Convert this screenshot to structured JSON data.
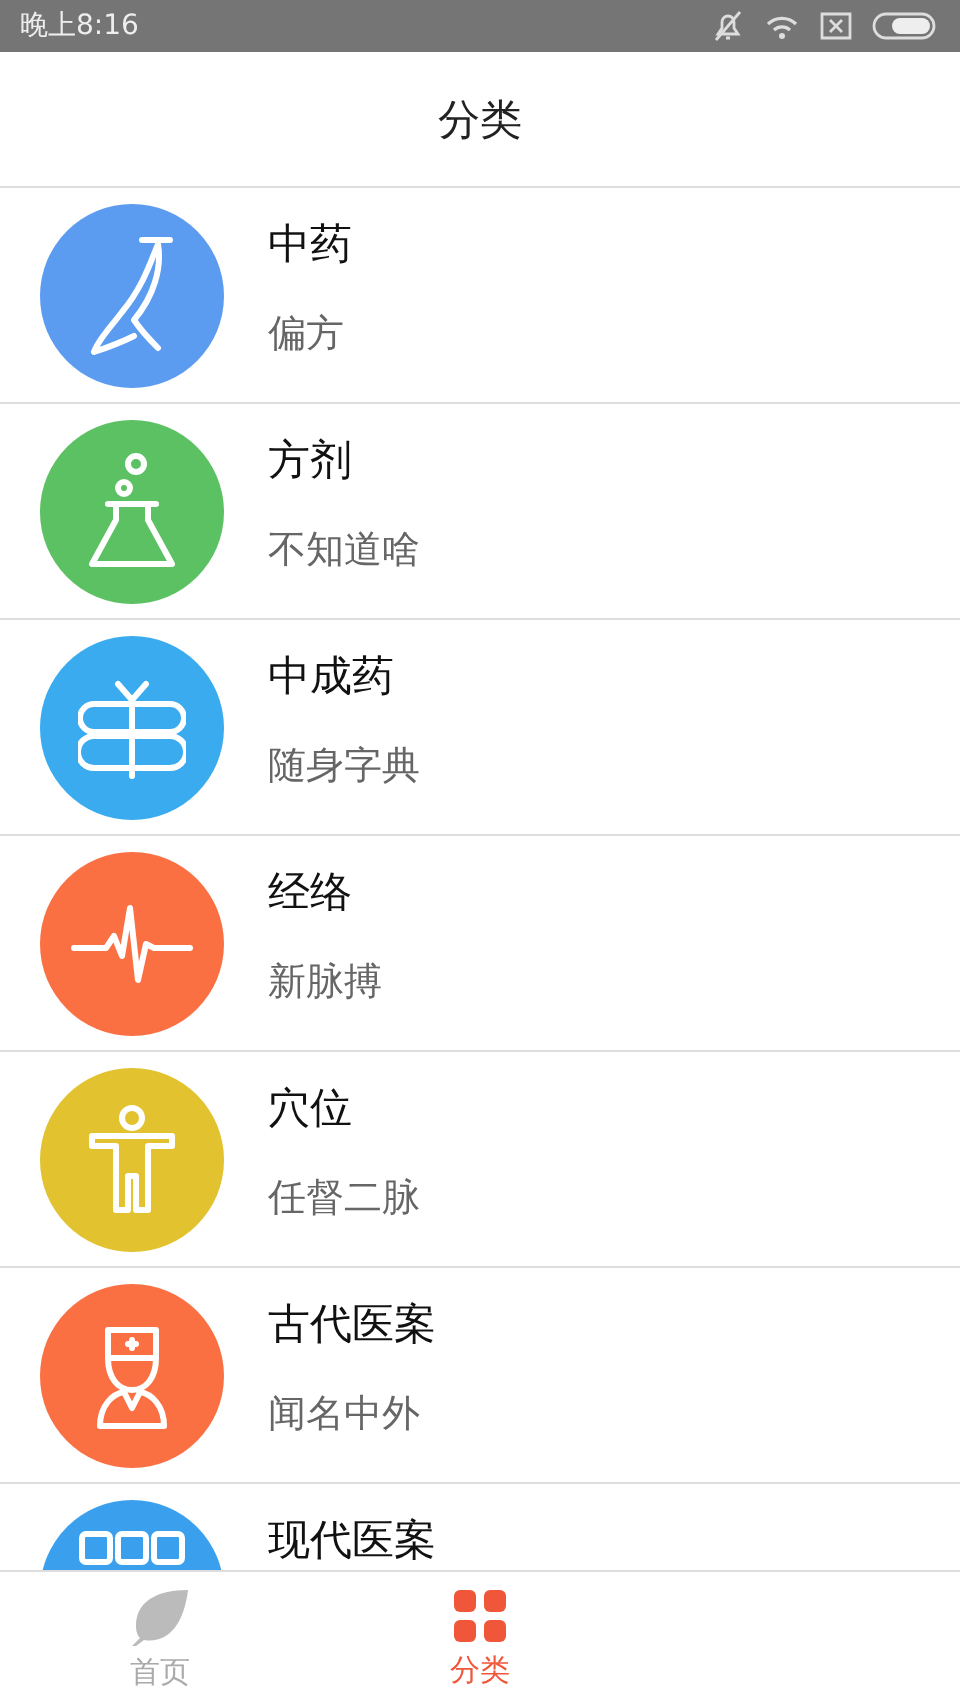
{
  "status_bar": {
    "time": "晚上8:16"
  },
  "header": {
    "title": "分类"
  },
  "categories": [
    {
      "title": "中药",
      "subtitle": "偏方",
      "kind": "root",
      "color": "#5b9cf0"
    },
    {
      "title": "方剂",
      "subtitle": "不知道啥",
      "kind": "flask",
      "color": "#5cc162"
    },
    {
      "title": "中成药",
      "subtitle": "随身字典",
      "kind": "gift",
      "color": "#3aabef"
    },
    {
      "title": "经络",
      "subtitle": "新脉搏",
      "kind": "pulse",
      "color": "#fb7043"
    },
    {
      "title": "穴位",
      "subtitle": "任督二脉",
      "kind": "figure",
      "color": "#e2c22f"
    },
    {
      "title": "古代医案",
      "subtitle": "闻名中外",
      "kind": "doctor",
      "color": "#fb7043"
    },
    {
      "title": "现代医案",
      "kind": "grid",
      "color": "#3aa0ee"
    }
  ],
  "tabs": [
    {
      "label": "首页",
      "kind": "leaf",
      "selected": false
    },
    {
      "label": "分类",
      "kind": "grid",
      "selected": true
    }
  ]
}
